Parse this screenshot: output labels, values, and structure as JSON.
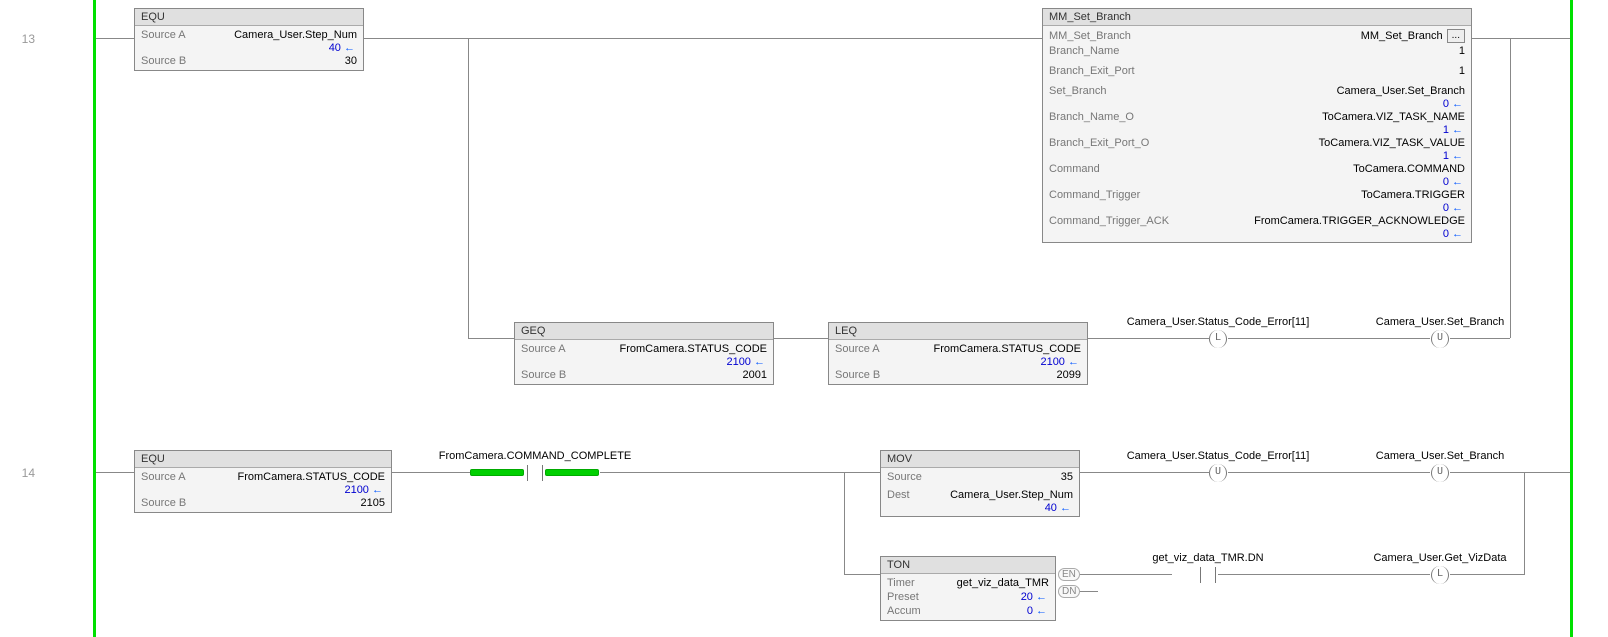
{
  "rungs": {
    "r13": "13",
    "r14": "14"
  },
  "equ1": {
    "title": "EQU",
    "srcA_label": "Source A",
    "srcA_val": "Camera_User.Step_Num",
    "srcA_sub": "40",
    "srcB_label": "Source B",
    "srcB_val": "30"
  },
  "mm_set_branch": {
    "title": "MM_Set_Branch",
    "rows": [
      {
        "label": "MM_Set_Branch",
        "val": "MM_Set_Branch",
        "dots": true
      },
      {
        "label": "Branch_Name",
        "val": "1"
      },
      {
        "label": "Branch_Exit_Port",
        "val": "1",
        "gap": true
      },
      {
        "label": "Set_Branch",
        "val": "Camera_User.Set_Branch",
        "sub": "0",
        "gap": true
      },
      {
        "label": "Branch_Name_O",
        "val": "ToCamera.VIZ_TASK_NAME",
        "sub": "1"
      },
      {
        "label": "Branch_Exit_Port_O",
        "val": "ToCamera.VIZ_TASK_VALUE",
        "sub": "1"
      },
      {
        "label": "Command",
        "val": "ToCamera.COMMAND",
        "sub": "0"
      },
      {
        "label": "Command_Trigger",
        "val": "ToCamera.TRIGGER",
        "sub": "0"
      },
      {
        "label": "Command_Trigger_ACK",
        "val": "FromCamera.TRIGGER_ACKNOWLEDGE",
        "sub": "0"
      }
    ]
  },
  "geq": {
    "title": "GEQ",
    "srcA_label": "Source A",
    "srcA_val": "FromCamera.STATUS_CODE",
    "srcA_sub": "2100",
    "srcB_label": "Source B",
    "srcB_val": "2001"
  },
  "leq": {
    "title": "LEQ",
    "srcA_label": "Source A",
    "srcA_val": "FromCamera.STATUS_CODE",
    "srcA_sub": "2100",
    "srcB_label": "Source B",
    "srcB_val": "2099"
  },
  "coil_err_L": "Camera_User.Status_Code_Error[11]",
  "coil_setbranch_U": "Camera_User.Set_Branch",
  "equ2": {
    "title": "EQU",
    "srcA_label": "Source A",
    "srcA_val": "FromCamera.STATUS_CODE",
    "srcA_sub": "2100",
    "srcB_label": "Source B",
    "srcB_val": "2105"
  },
  "xic_cmd_complete": "FromCamera.COMMAND_COMPLETE",
  "mov": {
    "title": "MOV",
    "src_label": "Source",
    "src_val": "35",
    "dest_label": "Dest",
    "dest_val": "Camera_User.Step_Num",
    "dest_sub": "40"
  },
  "coil_err_U": "Camera_User.Status_Code_Error[11]",
  "coil_setbranch_U2": "Camera_User.Set_Branch",
  "ton": {
    "title": "TON",
    "timer_label": "Timer",
    "timer_val": "get_viz_data_TMR",
    "preset_label": "Preset",
    "preset_val": "20",
    "accum_label": "Accum",
    "accum_val": "0"
  },
  "en_label": "EN",
  "dn_label": "DN",
  "xic_tmr_dn": "get_viz_data_TMR.DN",
  "coil_get_viz": "Camera_User.Get_VizData",
  "letters": {
    "L": "L",
    "U": "U"
  }
}
